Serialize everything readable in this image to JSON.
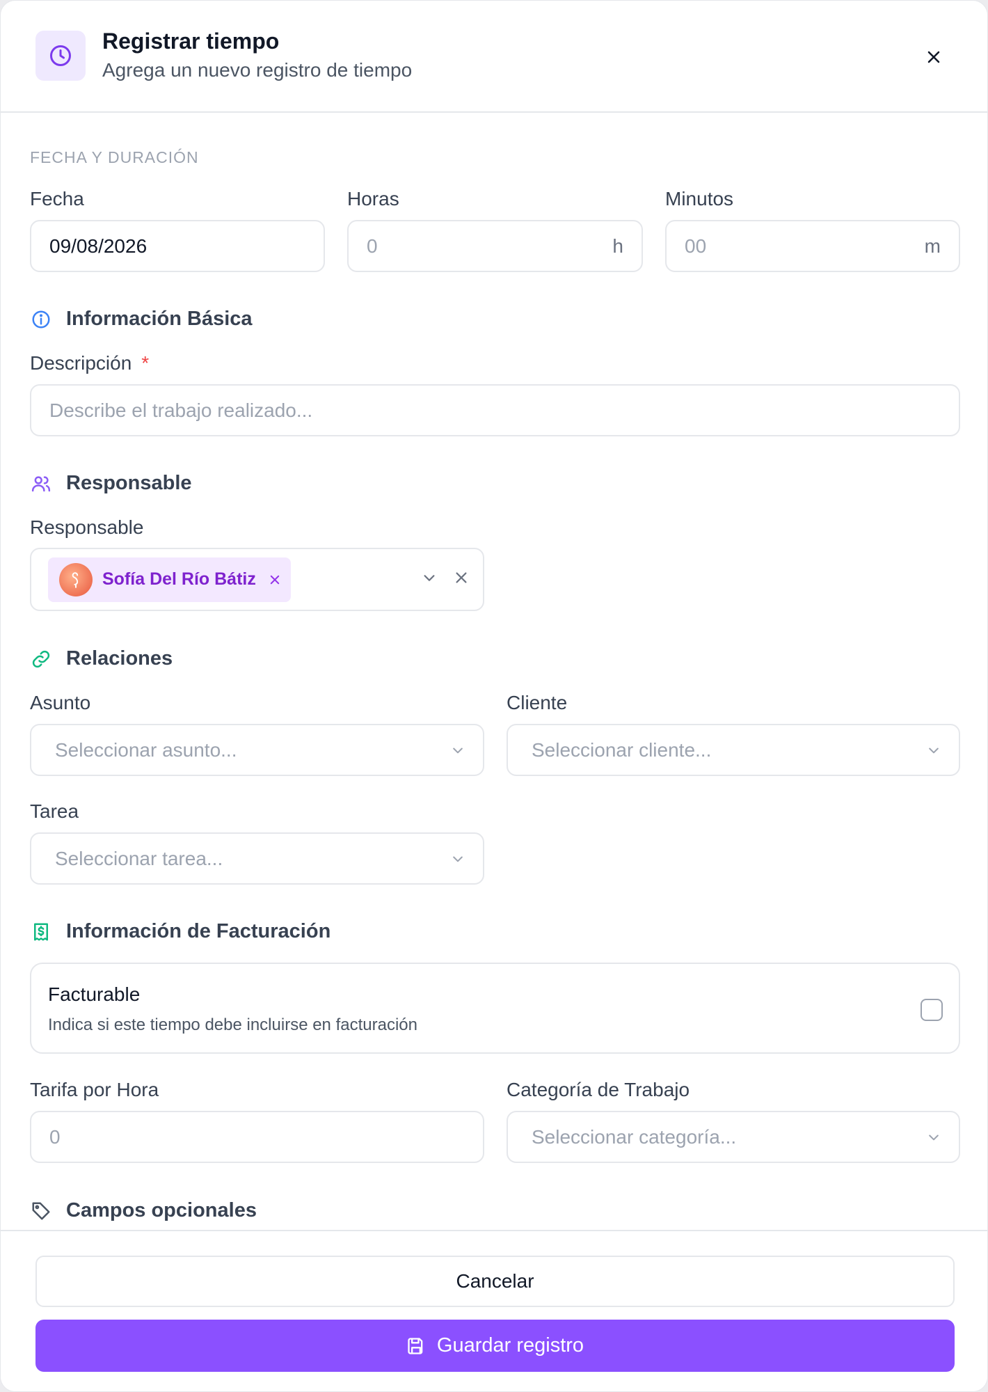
{
  "header": {
    "title": "Registrar tiempo",
    "subtitle": "Agrega un nuevo registro de tiempo"
  },
  "date_duration": {
    "section_label": "FECHA Y DURACIÓN",
    "fecha_label": "Fecha",
    "fecha_value": "09/08/2026",
    "horas_label": "Horas",
    "horas_placeholder": "0",
    "horas_suffix": "h",
    "minutos_label": "Minutos",
    "minutos_placeholder": "00",
    "minutos_suffix": "m"
  },
  "basic_info": {
    "title": "Información Básica",
    "descripcion_label": "Descripción",
    "required_mark": "*",
    "descripcion_placeholder": "Describe el trabajo realizado..."
  },
  "responsable": {
    "title": "Responsable",
    "label": "Responsable",
    "selected": "Sofía Del Río Bátiz"
  },
  "relaciones": {
    "title": "Relaciones",
    "asunto_label": "Asunto",
    "asunto_placeholder": "Seleccionar asunto...",
    "cliente_label": "Cliente",
    "cliente_placeholder": "Seleccionar cliente...",
    "tarea_label": "Tarea",
    "tarea_placeholder": "Seleccionar tarea..."
  },
  "facturacion": {
    "title": "Información de Facturación",
    "facturable_title": "Facturable",
    "facturable_desc": "Indica si este tiempo debe incluirse en facturación",
    "facturable_checked": false,
    "tarifa_label": "Tarifa por Hora",
    "tarifa_placeholder": "0",
    "categoria_label": "Categoría de Trabajo",
    "categoria_placeholder": "Seleccionar categoría..."
  },
  "optional": {
    "title": "Campos opcionales"
  },
  "footer": {
    "cancel_label": "Cancelar",
    "save_label": "Guardar registro"
  },
  "colors": {
    "accent": "#8b50ff",
    "info_icon": "#3b82f6",
    "link_icon": "#10b981",
    "billing_icon": "#10b981",
    "user_icon": "#8b5cf6"
  }
}
